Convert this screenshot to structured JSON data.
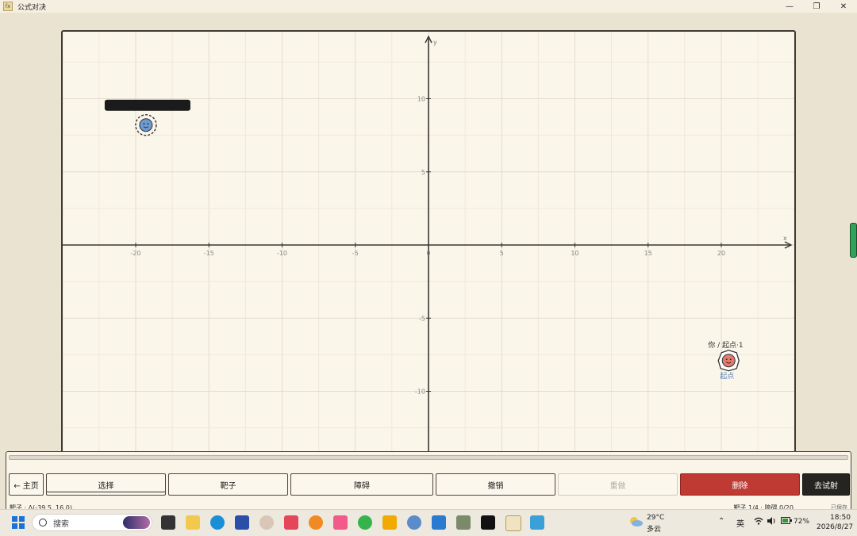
{
  "window": {
    "title": "公式对决",
    "app_icon": "fx",
    "controls": [
      "minimize-icon",
      "restore-icon",
      "close-icon"
    ]
  },
  "graph": {
    "x_axis_label": "x",
    "y_axis_label": "y",
    "x_ticks": [
      "-20",
      "-15",
      "-10",
      "-5",
      "0",
      "5",
      "10",
      "15",
      "20"
    ],
    "y_ticks": [
      "10",
      "5",
      "-5",
      "-10"
    ],
    "x_range": [
      -25,
      25
    ],
    "y_range": [
      -14.5,
      14.5
    ],
    "targets": [
      {
        "x": -19.3,
        "y": 8.2,
        "color": "#6c9bd1",
        "label": "已涂黑的名称",
        "redacted": true
      }
    ],
    "player": {
      "x": 20.5,
      "y": -7.9,
      "color": "#e47a6b",
      "title": "你 / 起点·1",
      "label": "起点"
    }
  },
  "toolbar": {
    "home": "← 主页",
    "select": "选择",
    "target": "靶子",
    "obstacle": "障碍",
    "undo": "撤销",
    "redo": "重做",
    "delete": "删除",
    "fire": "去试射"
  },
  "status": {
    "left": "靶子 · Δ(-39.5, 16.0)",
    "right": "靶子 1/4 · 障碍 0/20",
    "saved": "已保存"
  },
  "taskbar": {
    "search_placeholder": "搜索",
    "weather_temp": "29°C",
    "weather_desc": "多云",
    "ime": "英",
    "battery": "72%",
    "time": "18:50",
    "date": "2026/8/27"
  }
}
